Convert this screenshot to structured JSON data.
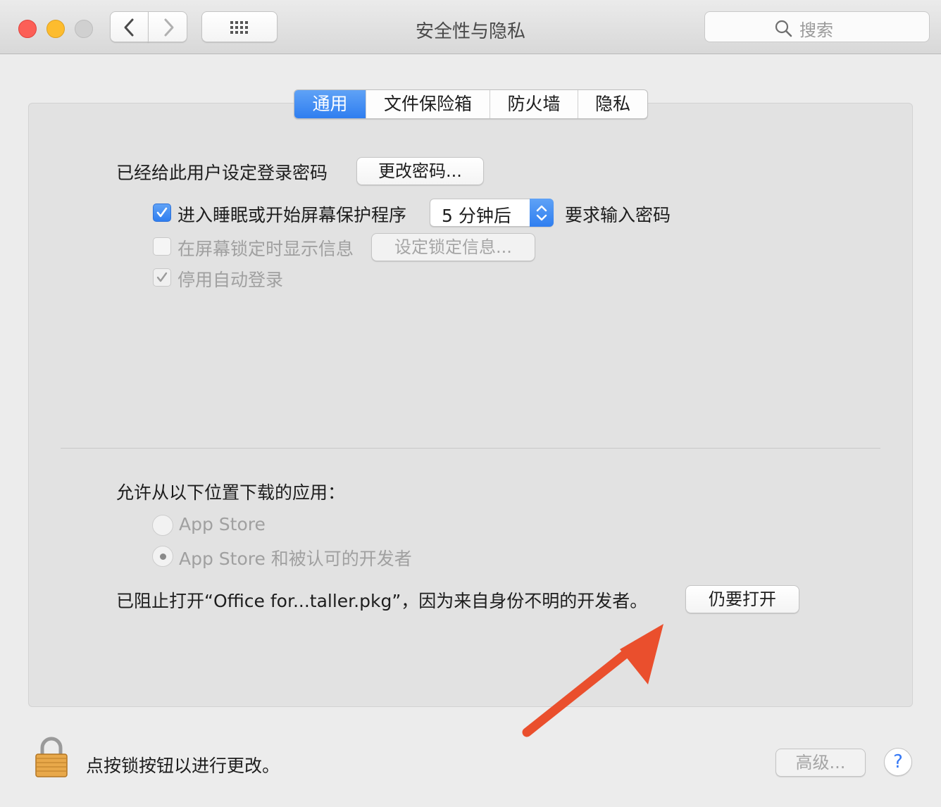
{
  "window": {
    "title": "安全性与隐私",
    "search_placeholder": "搜索",
    "traffic_lights": {
      "close": "#fc5f57",
      "minimize": "#fdbc2e",
      "zoom": "#d0d0d0"
    },
    "nav": {
      "back_icon": "chevron-left-icon",
      "forward_icon": "chevron-right-icon",
      "grid_icon": "grid-icon"
    }
  },
  "tabs": [
    {
      "label": "通用",
      "active": true
    },
    {
      "label": "文件保险箱",
      "active": false
    },
    {
      "label": "防火墙",
      "active": false
    },
    {
      "label": "隐私",
      "active": false
    }
  ],
  "general": {
    "password_set_label": "已经给此用户设定登录密码",
    "change_password_button": "更改密码...",
    "sleep_checkbox": {
      "label": "进入睡眠或开始屏幕保护程序",
      "checked": true
    },
    "sleep_select_value": "5 分钟后",
    "require_password_label": "要求输入密码",
    "lock_message_checkbox": {
      "label": "在屏幕锁定时显示信息",
      "checked": false
    },
    "set_lock_message_button": "设定锁定信息...",
    "disable_autologin_checkbox": {
      "label": "停用自动登录",
      "checked": true
    }
  },
  "downloads": {
    "heading": "允许从以下位置下载的应用：",
    "options": [
      {
        "label": "App Store",
        "selected": false
      },
      {
        "label": "App Store 和被认可的开发者",
        "selected": true
      }
    ],
    "blocked_message": "已阻止打开“Office for...taller.pkg”，因为来自身份不明的开发者。",
    "open_anyway_button": "仍要打开"
  },
  "footer": {
    "lock_text": "点按锁按钮以进行更改。",
    "advanced_button": "高级...",
    "help_button": "?"
  },
  "colors": {
    "accent": "#2f7ef0",
    "annotation_arrow": "#ea4f2d"
  }
}
